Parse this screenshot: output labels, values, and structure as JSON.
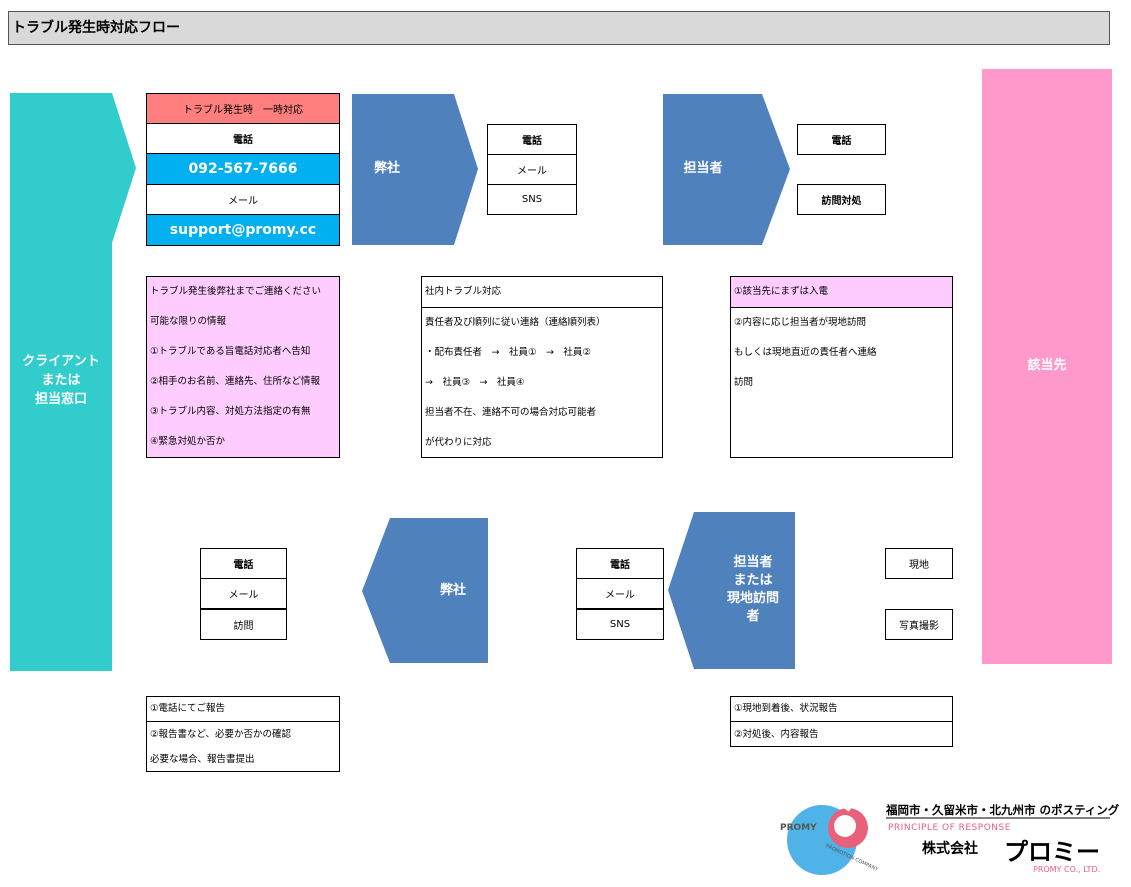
{
  "title": "トラブル発生時対応フロー",
  "left_bar": {
    "label": "クライアント\nまたは\n担当窓口",
    "color": "#33cccc"
  },
  "right_bar": {
    "label": "該当先",
    "color": "#ff99cc"
  },
  "contact_box": {
    "header": "トラブル発生時　一時対応",
    "phone_label": "電話",
    "phone": "092-567-7666",
    "mail_label": "メール",
    "email": "support@promy.cc"
  },
  "arrows": {
    "company_top": "弊社",
    "staff_top": "担当者",
    "company_bottom": "弊社",
    "staff_bottom": "担当者\nまたは\n現地訪問\n者"
  },
  "channels_company_top": [
    "電話",
    "メール",
    "SNS"
  ],
  "channels_staff_top": [
    "電話",
    "訪問対処"
  ],
  "channels_company_bottom": [
    "電話",
    "メール",
    "訪問"
  ],
  "channels_staff_bottom": [
    "電話",
    "メール",
    "SNS"
  ],
  "site_items": [
    "現地",
    "写真撮影"
  ],
  "note_client": [
    "トラブル発生後弊社までご連絡ください",
    "可能な限りの情報",
    "①トラブルである旨電話対応者へ告知",
    "②相手のお名前、連絡先、住所など情報",
    "③トラブル内容、対処方法指定の有無",
    "④緊急対処か否か"
  ],
  "note_internal": [
    "社内トラブル対応",
    "責任者及び順列に従い連絡（連絡順列表）",
    "・配布責任者　→　社員①　→　社員②",
    "→　社員③　→　社員④",
    "担当者不在、連絡不可の場合対応可能者",
    "が代わりに対応"
  ],
  "note_site": [
    "①該当先にまずは入電",
    "②内容に応じ担当者が現地訪問",
    "もしくは現地直近の責任者へ連絡",
    "訪問"
  ],
  "note_report_company": [
    "①電話にてご報告",
    "②報告書など、必要か否かの確認",
    "必要な場合、報告書提出"
  ],
  "note_report_staff": [
    "①現地到着後、状況報告",
    "②対処後、内容報告"
  ],
  "logo": {
    "area_text": "福岡市・久留米市・北九州市 のポスティング",
    "tagline": "PRINCIPLE OF RESPONSE",
    "company_prefix": "株式会社",
    "company_name": "プロミー",
    "company_en": "PROMY CO., LTD.",
    "emblem_text": "PROMY",
    "emblem_sub": "PROMOTION COMPANY"
  },
  "colors": {
    "arrow": "#4f81bd",
    "blue_cell": "#00b0f0",
    "pink_note": "#ffccff",
    "pink_header": "#ff7f7f"
  }
}
